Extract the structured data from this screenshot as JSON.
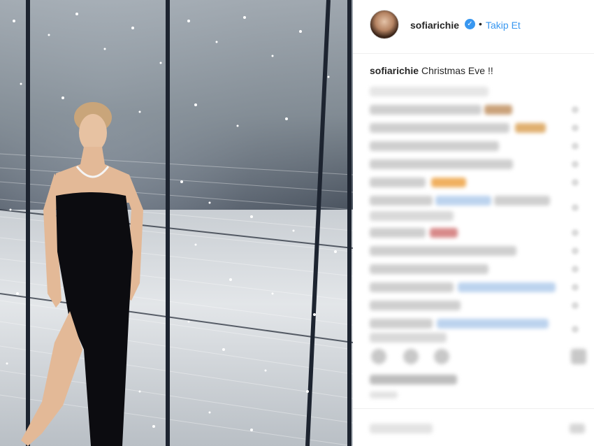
{
  "header": {
    "username": "sofiarichie",
    "separator": "•",
    "follow_label": "Takip Et"
  },
  "caption": {
    "username": "sofiarichie",
    "text": "Christmas Eve !!"
  },
  "colors": {
    "link_blue": "#3897f0",
    "text": "#262626",
    "border": "#efefef"
  },
  "icons": {
    "verified": "verified-badge-icon",
    "avatar": "profile-avatar"
  }
}
